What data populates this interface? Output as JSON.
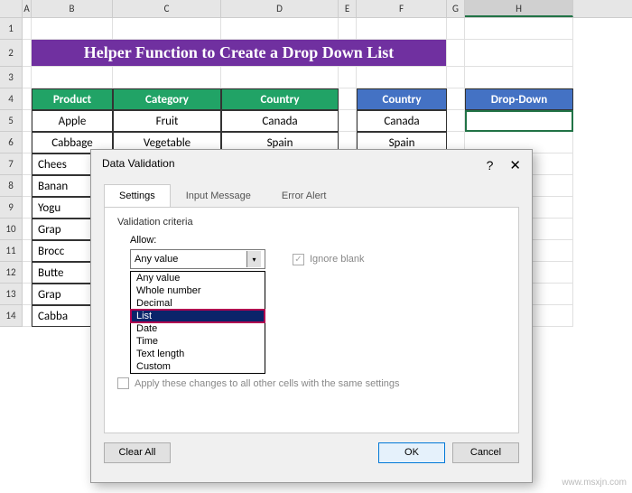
{
  "columns": [
    "A",
    "B",
    "C",
    "D",
    "E",
    "F",
    "G",
    "H"
  ],
  "active_column": "H",
  "title": "Helper Function to Create a Drop Down List",
  "headers": {
    "product": "Product",
    "category": "Category",
    "country": "Country",
    "country2": "Country",
    "dropdown": "Drop-Down"
  },
  "rows": [
    {
      "n": "5",
      "b": "Apple",
      "c": "Fruit",
      "d": "Canada",
      "f": "Canada"
    },
    {
      "n": "6",
      "b": "Cabbage",
      "c": "Vegetable",
      "d": "Spain",
      "f": "Spain"
    },
    {
      "n": "7",
      "b": "Chees"
    },
    {
      "n": "8",
      "b": "Banan"
    },
    {
      "n": "9",
      "b": "Yogu"
    },
    {
      "n": "10",
      "b": "Grap"
    },
    {
      "n": "11",
      "b": "Brocc"
    },
    {
      "n": "12",
      "b": "Butte"
    },
    {
      "n": "13",
      "b": "Grap"
    },
    {
      "n": "14",
      "b": "Cabba"
    }
  ],
  "dialog": {
    "title": "Data Validation",
    "help": "?",
    "close": "✕",
    "tabs": {
      "settings": "Settings",
      "input": "Input Message",
      "error": "Error Alert"
    },
    "criteria_label": "Validation criteria",
    "allow_label": "Allow:",
    "allow_value": "Any value",
    "ignore_blank": "Ignore blank",
    "options": [
      "Any value",
      "Whole number",
      "Decimal",
      "List",
      "Date",
      "Time",
      "Text length",
      "Custom"
    ],
    "highlighted_option": "List",
    "apply_label": "Apply these changes to all other cells with the same settings",
    "clear_all": "Clear All",
    "ok": "OK",
    "cancel": "Cancel"
  },
  "watermark": "www.msxjn.com",
  "check": "✓",
  "chevron": "▾"
}
